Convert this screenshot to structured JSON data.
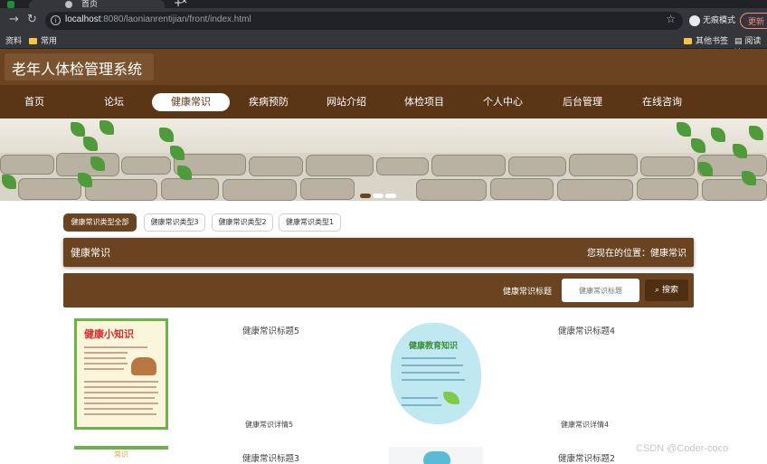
{
  "browser": {
    "tab_title": "首页",
    "url_host": "localhost",
    "url_rest": ":8080/laonianrentijian/front/index.html",
    "incognito_label": "无痕模式",
    "update_label": "更新",
    "bookmarks": [
      "资料",
      "常用",
      "其他书签",
      "阅读清"
    ]
  },
  "site": {
    "title": "老年人体检管理系统",
    "nav": [
      "首页",
      "论坛",
      "健康常识",
      "疾病预防",
      "网站介绍",
      "体检项目",
      "个人中心",
      "后台管理",
      "在线咨询"
    ],
    "active_nav_index": 2
  },
  "categories": {
    "items": [
      "健康常识类型全部",
      "健康常识类型3",
      "健康常识类型2",
      "健康常识类型1"
    ],
    "active_index": 0
  },
  "section": {
    "title": "健康常识",
    "location": "您现在的位置：健康常识"
  },
  "search": {
    "label": "健康常识标题",
    "placeholder": "健康常识标题",
    "button_label": "搜索"
  },
  "articles": [
    {
      "title": "健康常识标题5",
      "detail": "健康常识详情5",
      "image_text": "健康小知识"
    },
    {
      "title": "健康常识标题4",
      "detail": "健康常识详情4",
      "image_text": "健康教育知识"
    },
    {
      "title": "健康常识标题3",
      "detail": "",
      "image_text": "常识"
    },
    {
      "title": "健康常识标题2",
      "detail": "",
      "image_text": ""
    }
  ],
  "watermark": "CSDN @Coder-coco",
  "colors": {
    "brand_brown": "#6a4420",
    "nav_brown": "#5a3616",
    "button_dark": "#4e2f12"
  }
}
